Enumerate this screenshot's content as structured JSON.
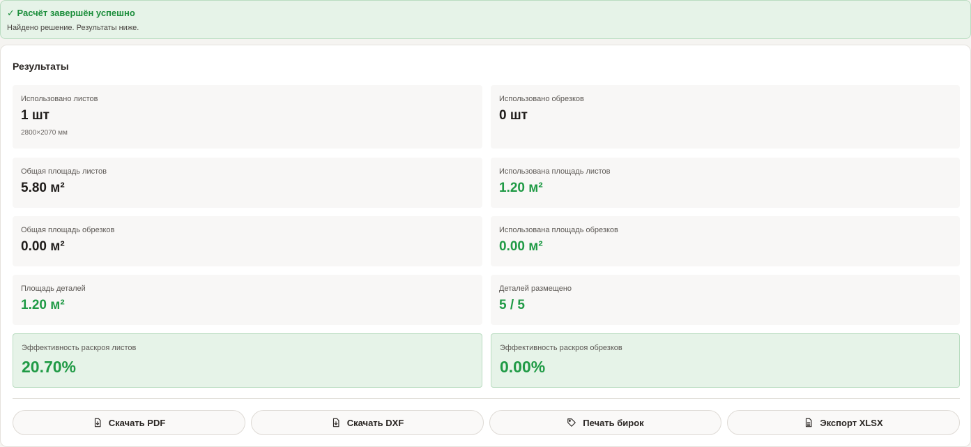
{
  "alert": {
    "title": "✓ Расчёт завершён успешно",
    "message": "Найдено решение. Результаты ниже."
  },
  "results": {
    "title": "Результаты",
    "sheets_used": {
      "label": "Использовано листов",
      "value": "1 шт",
      "sub": "2800×2070 мм"
    },
    "offcuts_used": {
      "label": "Использовано обрезков",
      "value": "0 шт"
    },
    "sheets_total_area": {
      "label": "Общая площадь листов",
      "value": "5.80 м²"
    },
    "sheets_used_area": {
      "label": "Использована площадь листов",
      "value": "1.20 м²"
    },
    "offcuts_total_area": {
      "label": "Общая площадь обрезков",
      "value": "0.00 м²"
    },
    "offcuts_used_area": {
      "label": "Использована площадь обрезков",
      "value": "0.00 м²"
    },
    "parts_area": {
      "label": "Площадь деталей",
      "value": "1.20 м²"
    },
    "parts_placed": {
      "label": "Деталей размещено",
      "value": "5 / 5"
    },
    "sheets_efficiency": {
      "label": "Эффективность раскроя листов",
      "value": "20.70%"
    },
    "offcuts_efficiency": {
      "label": "Эффективность раскроя обрезков",
      "value": "0.00%"
    }
  },
  "actions": {
    "pdf": "Скачать PDF",
    "dxf": "Скачать DXF",
    "labels": "Печать бирок",
    "xlsx": "Экспорт XLSX"
  },
  "colors": {
    "success": "#1f9a45",
    "success_bg": "#e6f3e8"
  }
}
